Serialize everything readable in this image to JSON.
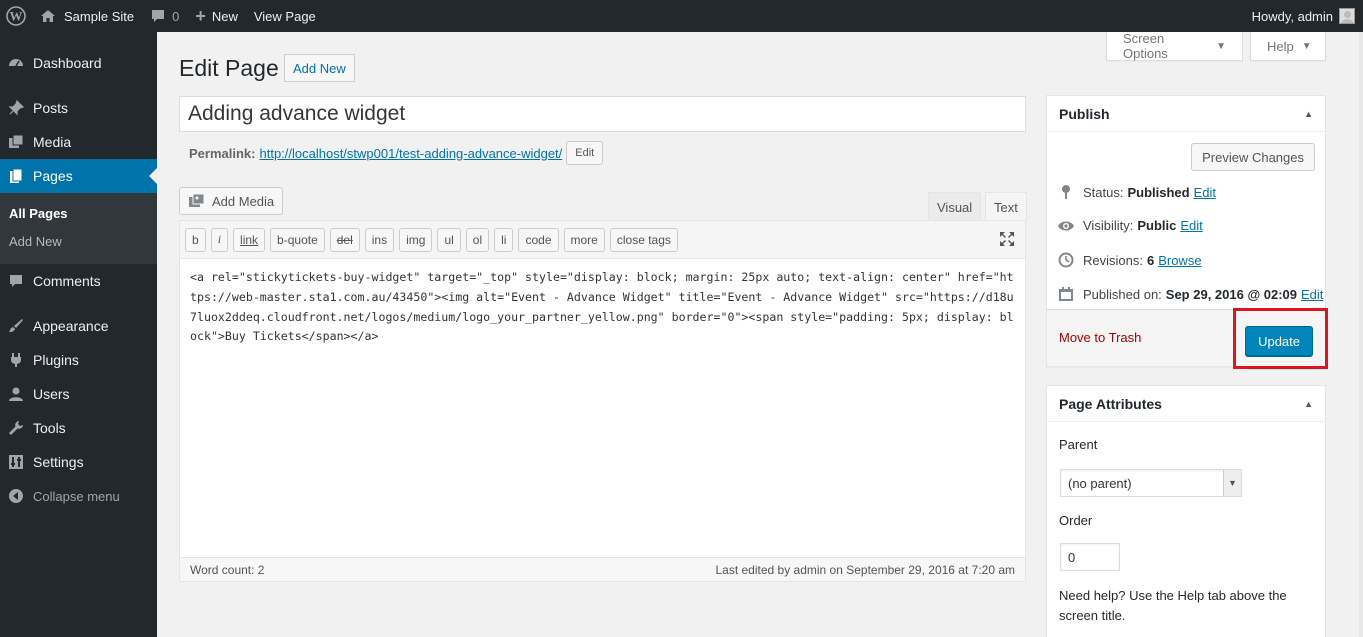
{
  "adminbar": {
    "site_name": "Sample Site",
    "comments_count": "0",
    "new_label": "New",
    "view_page_label": "View Page",
    "howdy": "Howdy, admin"
  },
  "sidebar": {
    "items": [
      {
        "label": "Dashboard",
        "icon": "dashboard-icon"
      },
      {
        "label": "Posts",
        "icon": "pin-icon"
      },
      {
        "label": "Media",
        "icon": "media-icon"
      },
      {
        "label": "Pages",
        "icon": "pages-icon"
      },
      {
        "label": "Comments",
        "icon": "comment-icon"
      },
      {
        "label": "Appearance",
        "icon": "brush-icon"
      },
      {
        "label": "Plugins",
        "icon": "plugin-icon"
      },
      {
        "label": "Users",
        "icon": "user-icon"
      },
      {
        "label": "Tools",
        "icon": "wrench-icon"
      },
      {
        "label": "Settings",
        "icon": "settings-icon"
      }
    ],
    "submenu": [
      "All Pages",
      "Add New"
    ],
    "collapse": "Collapse menu"
  },
  "screen_tabs": {
    "screen_options": "Screen Options",
    "help": "Help"
  },
  "header": {
    "title": "Edit Page",
    "add_new": "Add New"
  },
  "post": {
    "title": "Adding advance widget",
    "permalink_label": "Permalink:",
    "permalink_url": "http://localhost/stwp001/test-adding-advance-widget/",
    "permalink_edit": "Edit"
  },
  "editor": {
    "add_media": "Add Media",
    "tab_visual": "Visual",
    "tab_text": "Text",
    "quicktags": [
      "b",
      "i",
      "link",
      "b-quote",
      "del",
      "ins",
      "img",
      "ul",
      "ol",
      "li",
      "code",
      "more",
      "close tags"
    ],
    "content": "<a rel=\"stickytickets-buy-widget\" target=\"_top\" style=\"display: block; margin: 25px auto; text-align: center\" href=\"https://web-master.sta1.com.au/43450\"><img alt=\"Event - Advance Widget\" title=\"Event - Advance Widget\" src=\"https://d18u7luox2ddeq.cloudfront.net/logos/medium/logo_your_partner_yellow.png\" border=\"0\"><span style=\"padding: 5px; display: block\">Buy Tickets</span></a>",
    "word_count": "Word count: 2",
    "last_edited": "Last edited by admin on September 29, 2016 at 7:20 am"
  },
  "publish": {
    "title": "Publish",
    "preview": "Preview Changes",
    "status_label": "Status:",
    "status_value": "Published",
    "visibility_label": "Visibility:",
    "visibility_value": "Public",
    "revisions_label": "Revisions:",
    "revisions_value": "6",
    "browse": "Browse",
    "published_on_label": "Published on:",
    "published_on_value": "Sep 29, 2016 @ 02:09",
    "edit": "Edit",
    "trash": "Move to Trash",
    "update": "Update",
    "highlight_color": "#e0141e"
  },
  "page_attributes": {
    "title": "Page Attributes",
    "parent_label": "Parent",
    "parent_value": "(no parent)",
    "order_label": "Order",
    "order_value": "0",
    "help_text": "Need help? Use the Help tab above the screen title."
  }
}
